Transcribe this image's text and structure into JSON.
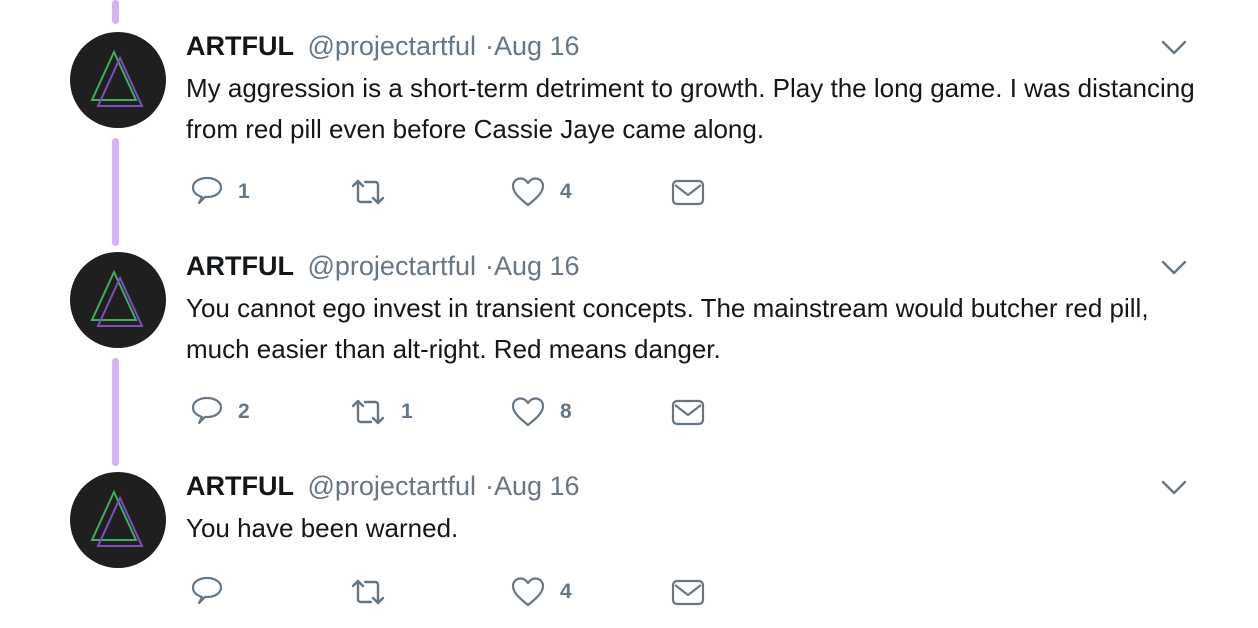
{
  "tweets": [
    {
      "author_name": "ARTFUL",
      "handle": "@projectartful",
      "dot": "·",
      "date": "Aug 16",
      "text": "My aggression is a short-term detriment to growth. Play the long game. I was distancing from red pill even before Cassie Jaye came along.",
      "replies": "1",
      "retweets": "",
      "likes": "4"
    },
    {
      "author_name": "ARTFUL",
      "handle": "@projectartful",
      "dot": "·",
      "date": "Aug 16",
      "text": "You cannot ego invest in transient concepts. The mainstream would butcher red pill, much easier than alt-right. Red means danger.",
      "replies": "2",
      "retweets": "1",
      "likes": "8"
    },
    {
      "author_name": "ARTFUL",
      "handle": "@projectartful",
      "dot": "·",
      "date": "Aug 16",
      "text": "You have been warned.",
      "replies": "",
      "retweets": "",
      "likes": "4"
    }
  ],
  "icons": {
    "reply": "reply-icon",
    "retweet": "retweet-icon",
    "like": "like-icon",
    "dm": "direct-message-icon",
    "caret": "chevron-down-icon",
    "avatar": "triangle-logo-icon"
  },
  "colors": {
    "thread_line": "#d4b3f5",
    "text": "#14171a",
    "secondary": "#657786",
    "avatar_bg": "#1f1f1f",
    "logo_green": "#3fae5e",
    "logo_purple": "#7c4fc0"
  }
}
